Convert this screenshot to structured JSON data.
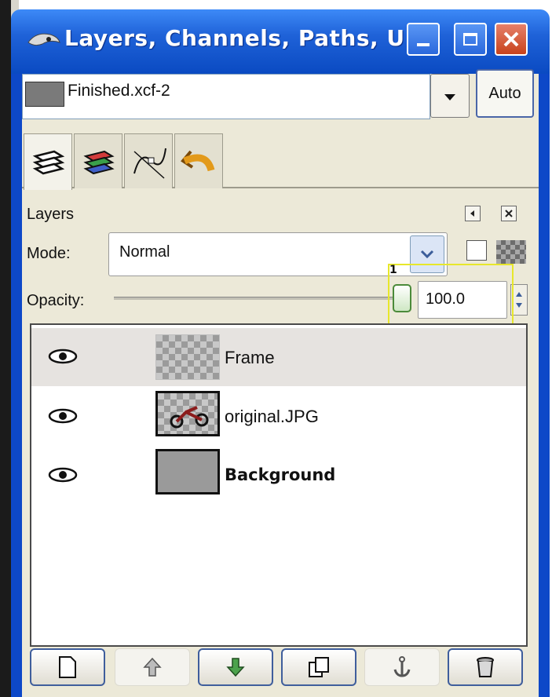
{
  "window": {
    "title": "Layers, Channels, Paths, U...",
    "titlebar_color": "#1f62d8",
    "controls": [
      "minimize-icon",
      "maximize-icon",
      "close-icon"
    ]
  },
  "image_selector": {
    "image_name": "Finished.xcf-2",
    "auto_label": "Auto"
  },
  "tabs": [
    {
      "name": "layers",
      "icon": "layers-icon",
      "active": true
    },
    {
      "name": "channels",
      "icon": "channels-icon",
      "active": false
    },
    {
      "name": "paths",
      "icon": "paths-icon",
      "active": false
    },
    {
      "name": "undo-history",
      "icon": "undo-history-icon",
      "active": false
    }
  ],
  "layers_panel": {
    "title": "Layers",
    "mode_label": "Mode:",
    "mode_value": "Normal",
    "opacity_label": "Opacity:",
    "opacity_value": "100.0",
    "highlight_label": "1",
    "highlight_color": "#e7e72b"
  },
  "layers": [
    {
      "name": "Frame",
      "visible": true,
      "selected": true
    },
    {
      "name": "original.JPG",
      "visible": true,
      "selected": false
    },
    {
      "name": "Background",
      "visible": true,
      "selected": false,
      "bold": true
    }
  ],
  "bottom_buttons": [
    {
      "name": "new-layer",
      "icon": "new-layer-icon"
    },
    {
      "name": "raise-layer",
      "icon": "raise-arrow-icon"
    },
    {
      "name": "lower-layer",
      "icon": "lower-arrow-icon"
    },
    {
      "name": "duplicate-layer",
      "icon": "duplicate-icon"
    },
    {
      "name": "anchor-layer",
      "icon": "anchor-icon"
    },
    {
      "name": "delete-layer",
      "icon": "trash-icon"
    }
  ]
}
